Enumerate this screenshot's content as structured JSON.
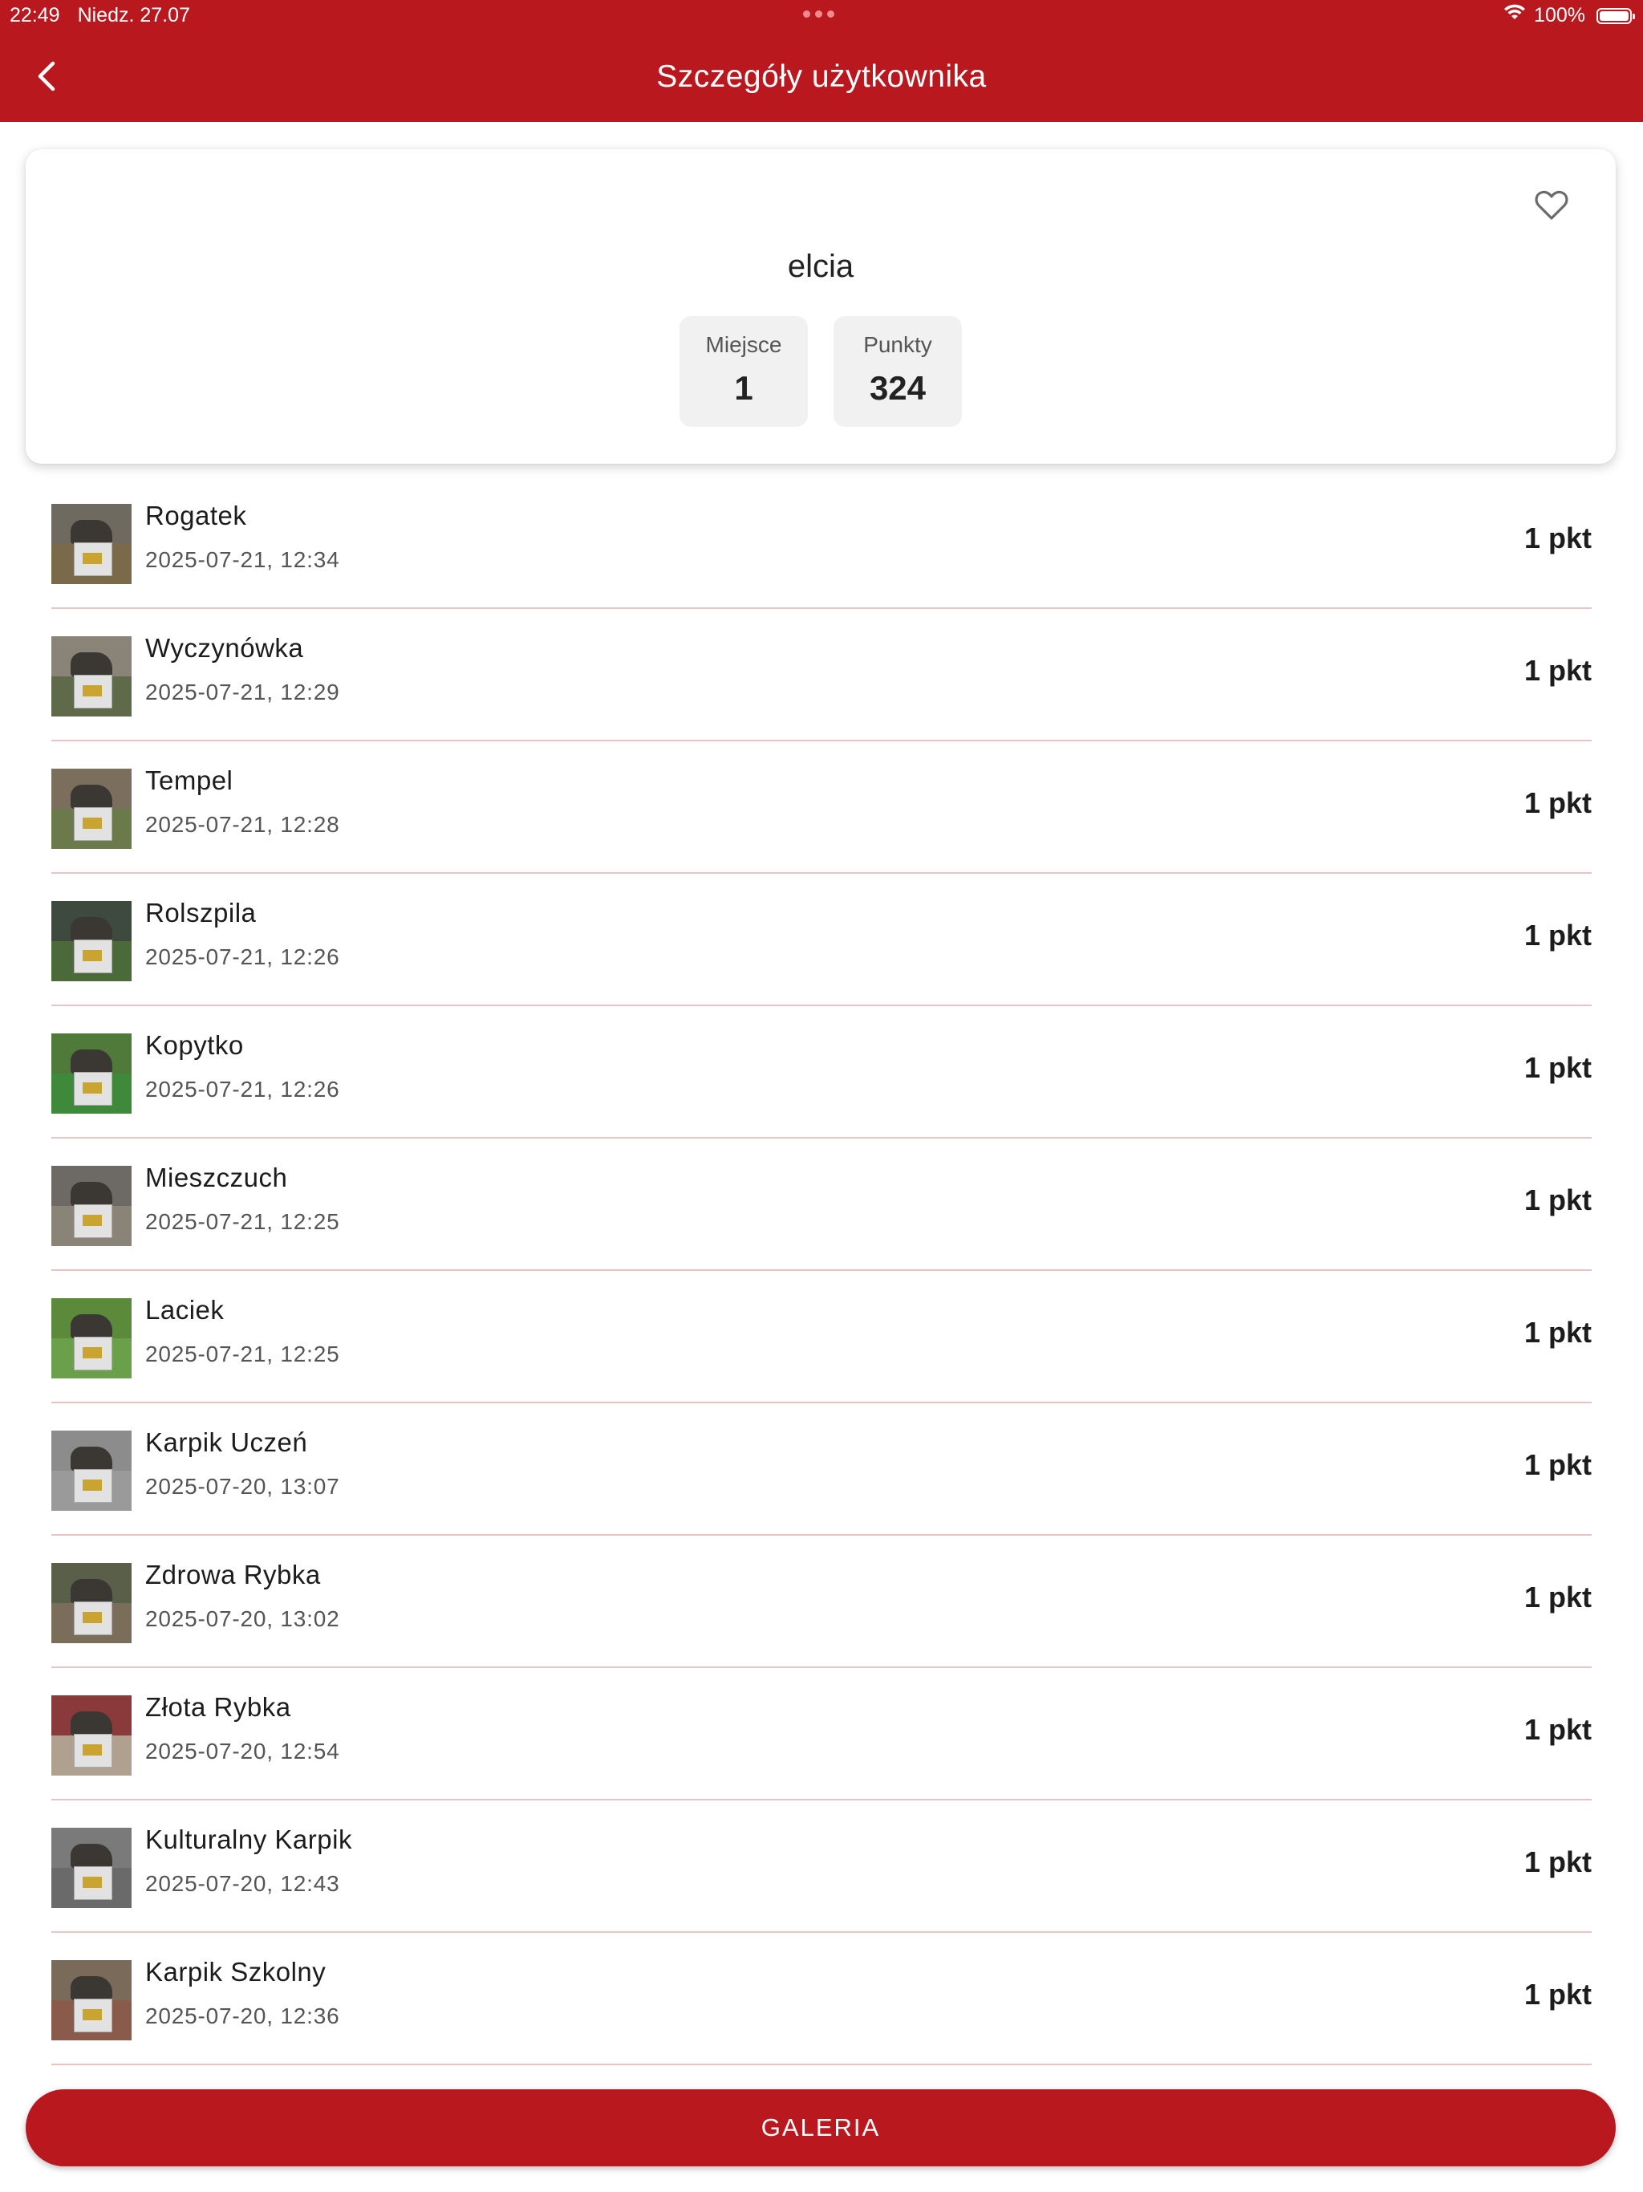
{
  "status_bar": {
    "time": "22:49",
    "date": "Niedz. 27.07",
    "battery": "100%"
  },
  "app_bar": {
    "title": "Szczegóły użytkownika"
  },
  "profile": {
    "username": "elcia",
    "stats": [
      {
        "label": "Miejsce",
        "value": "1"
      },
      {
        "label": "Punkty",
        "value": "324"
      }
    ]
  },
  "entries": [
    {
      "name": "Rogatek",
      "date": "2025-07-21, 12:34",
      "points": "1 pkt"
    },
    {
      "name": "Wyczynówka",
      "date": "2025-07-21, 12:29",
      "points": "1 pkt"
    },
    {
      "name": "Tempel",
      "date": "2025-07-21, 12:28",
      "points": "1 pkt"
    },
    {
      "name": "Rolszpila",
      "date": "2025-07-21, 12:26",
      "points": "1 pkt"
    },
    {
      "name": "Kopytko",
      "date": "2025-07-21, 12:26",
      "points": "1 pkt"
    },
    {
      "name": "Mieszczuch",
      "date": "2025-07-21, 12:25",
      "points": "1 pkt"
    },
    {
      "name": "Laciek",
      "date": "2025-07-21, 12:25",
      "points": "1 pkt"
    },
    {
      "name": "Karpik Uczeń",
      "date": "2025-07-20, 13:07",
      "points": "1 pkt"
    },
    {
      "name": "Zdrowa Rybka",
      "date": "2025-07-20, 13:02",
      "points": "1 pkt"
    },
    {
      "name": "Złota Rybka",
      "date": "2025-07-20, 12:54",
      "points": "1 pkt"
    },
    {
      "name": "Kulturalny Karpik",
      "date": "2025-07-20, 12:43",
      "points": "1 pkt"
    },
    {
      "name": "Karpik Szkolny",
      "date": "2025-07-20, 12:36",
      "points": "1 pkt"
    }
  ],
  "gallery_button": {
    "label": "GALERIA"
  },
  "colors": {
    "primary": "#b8181e",
    "divider": "#e8c4c4",
    "stat_bg": "#f1f1f1"
  },
  "icons": {
    "back": "chevron-left-icon",
    "favorite": "heart-outline-icon",
    "wifi": "wifi-icon",
    "battery": "battery-icon"
  }
}
